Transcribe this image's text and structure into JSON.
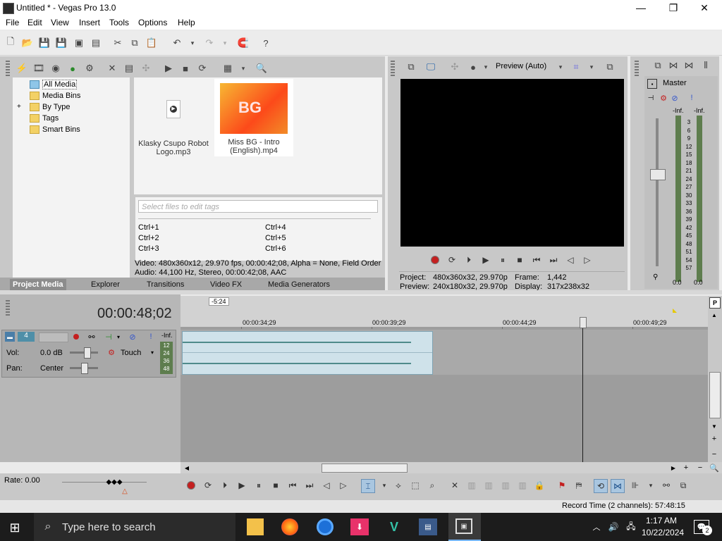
{
  "window": {
    "title": "Untitled * - Vegas Pro 13.0",
    "minimize_glyph": "—",
    "maximize_glyph": "❐",
    "close_glyph": "✕"
  },
  "menu": [
    "File",
    "Edit",
    "View",
    "Insert",
    "Tools",
    "Options",
    "Help"
  ],
  "media_tree": {
    "items": [
      {
        "label": "All Media",
        "selected": true
      },
      {
        "label": "Media Bins"
      },
      {
        "label": "By Type",
        "expander": "+"
      },
      {
        "label": "Tags"
      },
      {
        "label": "Smart Bins"
      }
    ]
  },
  "media_files": [
    {
      "name": "Klasky Csupo Robot Logo.mp3",
      "type": "audio"
    },
    {
      "name": "Miss BG - Intro (English).mp4",
      "type": "video",
      "selected": true,
      "thumb_text": "BG"
    }
  ],
  "tags": {
    "placeholder": "Select files to edit tags",
    "shortcuts": [
      "Ctrl+1",
      "Ctrl+2",
      "Ctrl+3",
      "Ctrl+4",
      "Ctrl+5",
      "Ctrl+6"
    ]
  },
  "media_info": {
    "video": "Video: 480x360x12, 29.970 fps, 00:00:42;08, Alpha = None, Field Order",
    "audio": "Audio: 44,100 Hz, Stereo, 00:00:42;08, AAC"
  },
  "bottom_tabs": [
    "Project Media",
    "Explorer",
    "Transitions",
    "Video FX",
    "Media Generators"
  ],
  "preview": {
    "mode_label": "Preview (Auto)",
    "project_label": "Project:",
    "project_value": "480x360x32, 29.970p",
    "preview_label": "Preview:",
    "preview_value": "240x180x32, 29.970p",
    "frame_label": "Frame:",
    "frame_value": "1,442",
    "display_label": "Display:",
    "display_value": "317x238x32"
  },
  "master": {
    "label": "Master",
    "left_peak": "-Inf.",
    "right_peak": "-Inf.",
    "scale": [
      "3",
      "6",
      "9",
      "12",
      "15",
      "18",
      "21",
      "24",
      "27",
      "30",
      "33",
      "36",
      "39",
      "42",
      "45",
      "48",
      "51",
      "54",
      "57"
    ],
    "left_value": "0.0",
    "right_value": "0.0"
  },
  "timeline": {
    "timecode": "00:00:48;02",
    "marker_label": "-5:24",
    "ruler": [
      "00:00:34;29",
      "00:00:39;29",
      "00:00:44;29",
      "00:00:49;29"
    ],
    "track": {
      "number": "4",
      "peak": "-Inf.",
      "vol_label": "Vol:",
      "vol_value": "0.0 dB",
      "pan_label": "Pan:",
      "pan_value": "Center",
      "automation_mode": "Touch",
      "meter_scale": [
        "12",
        "24",
        "36",
        "48"
      ]
    },
    "rate_label": "Rate: 0.00"
  },
  "status": {
    "record_time": "Record Time (2 channels): 57:48:15"
  },
  "taskbar": {
    "search_placeholder": "Type here to search",
    "time": "1:17 AM",
    "date": "10/22/2024",
    "notification_count": "2"
  }
}
